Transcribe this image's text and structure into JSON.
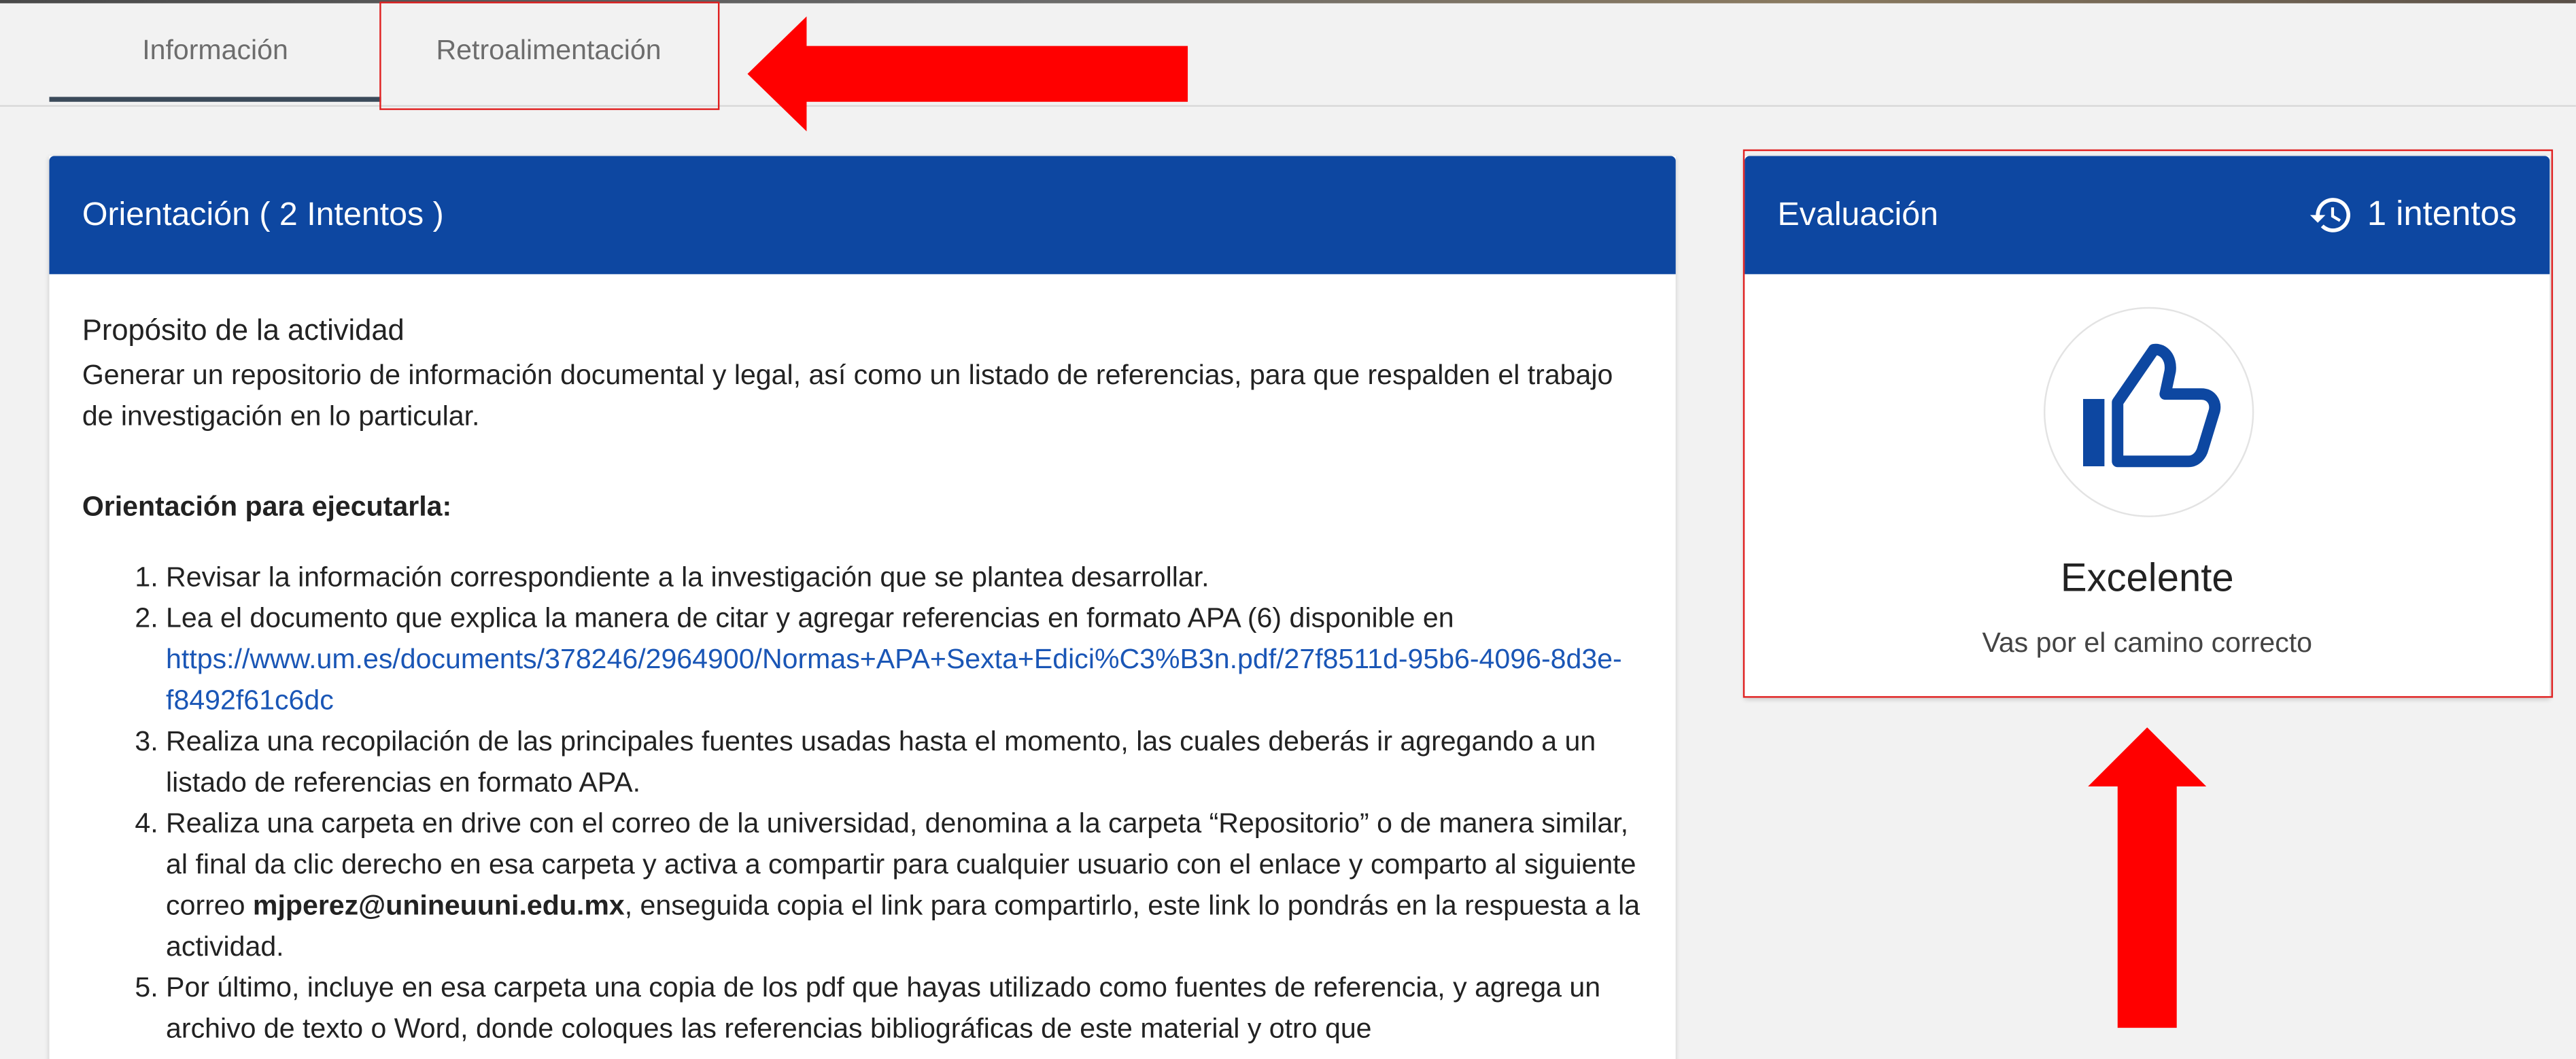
{
  "tabs": [
    {
      "label": "Información",
      "active": true
    },
    {
      "label": "Retroalimentación",
      "active": false
    }
  ],
  "main": {
    "header": "Orientación ( 2 Intentos )",
    "purpose_title": "Propósito de la actividad",
    "purpose_text": "Generar un repositorio de información documental y legal, así como un listado de referencias, para que respalden el trabajo de investigación en lo particular.",
    "orientation_title": "Orientación para ejecutarla:",
    "steps": {
      "s1": "Revisar la información correspondiente a la investigación que se plantea desarrollar.",
      "s2_pre": "Lea el documento que explica la manera de citar y agregar referencias en formato APA (6) disponible en ",
      "s2_link": "https://www.um.es/documents/378246/2964900/Normas+APA+Sexta+Edici%C3%B3n.pdf/27f8511d-95b6-4096-8d3e-f8492f61c6dc",
      "s3": "Realiza una recopilación de las principales fuentes usadas hasta el momento, las cuales deberás ir agregando a un listado de referencias en formato APA.",
      "s4_pre": "Realiza una carpeta en drive con el correo de la universidad, denomina a la carpeta “Repositorio” o de manera similar, al final da clic derecho en esa carpeta y activa a compartir para cualquier usuario con el enlace y comparto al siguiente correo ",
      "s4_email": "mjperez@unineuuni.edu.mx",
      "s4_post": ", enseguida copia el link para compartirlo, este link lo pondrás en la respuesta a la actividad.",
      "s5": "Por último, incluye en esa carpeta una copia de los pdf que hayas utilizado como fuentes de referencia, y agrega un archivo de texto o Word, donde coloques las referencias bibliográficas de este material y otro que"
    }
  },
  "evaluation": {
    "header": "Evaluación",
    "attempts": "1 intentos",
    "result": "Excelente",
    "message": "Vas por el camino correcto"
  },
  "colors": {
    "header_blue": "#0d47a1",
    "link_blue": "#1a56b6",
    "annotation_red": "#ff0000"
  },
  "icons": [
    "history-icon",
    "thumbs-up-icon"
  ]
}
